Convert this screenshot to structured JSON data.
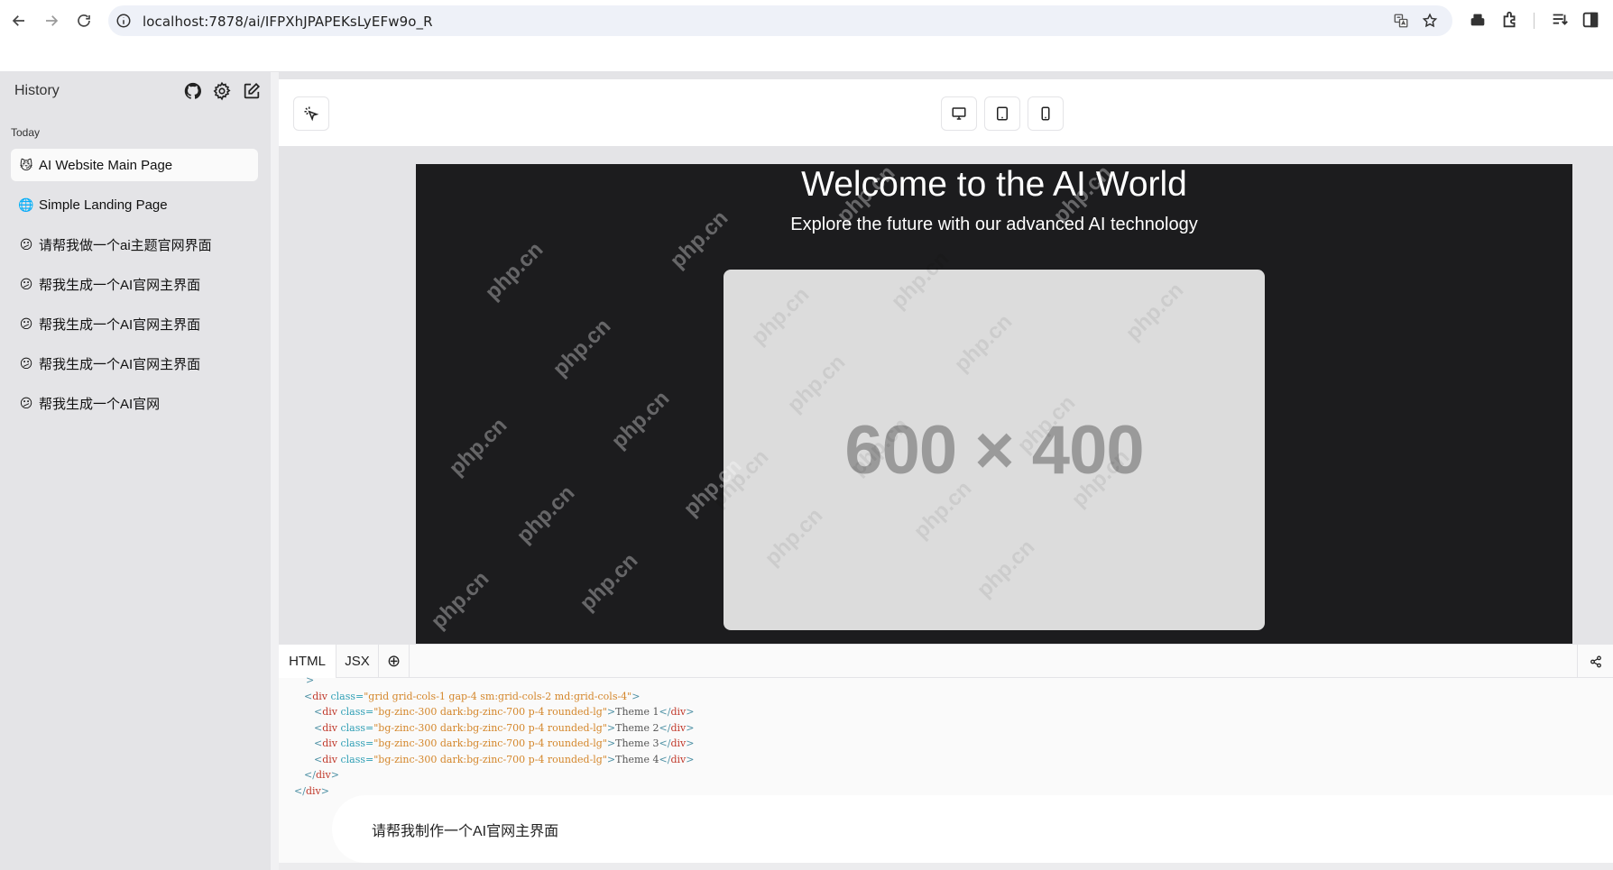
{
  "browser": {
    "url": "localhost:7878/ai/IFPXhJPAPEKsLyEFw9o_R"
  },
  "sidebar": {
    "title": "History",
    "section_label": "Today",
    "items": [
      {
        "icon": "robot-cat-emoji",
        "emoji": "😼",
        "label": "AI Website Main Page",
        "active": true
      },
      {
        "icon": "globe-emoji",
        "emoji": "🌐",
        "label": "Simple Landing Page",
        "active": false
      },
      {
        "icon": "confused-face-emoji",
        "emoji": "😕",
        "label": "请帮我做一个ai主题官网界面",
        "active": false
      },
      {
        "icon": "confused-face-emoji",
        "emoji": "😕",
        "label": "帮我生成一个AI官网主界面",
        "active": false
      },
      {
        "icon": "confused-face-emoji",
        "emoji": "😕",
        "label": "帮我生成一个AI官网主界面",
        "active": false
      },
      {
        "icon": "confused-face-emoji",
        "emoji": "😕",
        "label": "帮我生成一个AI官网主界面",
        "active": false
      },
      {
        "icon": "confused-face-emoji",
        "emoji": "😕",
        "label": "帮我生成一个AI官网",
        "active": false
      }
    ]
  },
  "preview": {
    "title": "Welcome to the AI World",
    "subtitle": "Explore the future with our advanced AI technology",
    "image_placeholder": "600 × 400",
    "watermark": "php.cn",
    "colors": {
      "background": "#1c1c1e",
      "placeholder": "#dcdcdc"
    }
  },
  "code_panel": {
    "tabs": [
      "HTML",
      "JSX"
    ],
    "add_tab_symbol": "⊕",
    "lines": [
      {
        "parts": [
          {
            "t": "tag",
            "v": ">"
          }
        ]
      },
      {
        "parts": [
          {
            "t": "tag",
            "v": "<"
          },
          {
            "t": "el",
            "v": "div"
          },
          {
            "t": "attr",
            "v": " class="
          },
          {
            "t": "str",
            "v": "\"grid grid-cols-1 gap-4 sm:grid-cols-2 md:grid-cols-4\""
          },
          {
            "t": "tag",
            "v": ">"
          }
        ]
      },
      {
        "parts": [
          {
            "t": "tag",
            "v": "<"
          },
          {
            "t": "el",
            "v": "div"
          },
          {
            "t": "attr",
            "v": " class="
          },
          {
            "t": "str",
            "v": "\"bg-zinc-300 dark:bg-zinc-700 p-4 rounded-lg\""
          },
          {
            "t": "tag",
            "v": ">"
          },
          {
            "t": "txt",
            "v": "Theme 1"
          },
          {
            "t": "tag",
            "v": "</"
          },
          {
            "t": "el",
            "v": "div"
          },
          {
            "t": "tag",
            "v": ">"
          }
        ]
      },
      {
        "parts": [
          {
            "t": "tag",
            "v": "<"
          },
          {
            "t": "el",
            "v": "div"
          },
          {
            "t": "attr",
            "v": " class="
          },
          {
            "t": "str",
            "v": "\"bg-zinc-300 dark:bg-zinc-700 p-4 rounded-lg\""
          },
          {
            "t": "tag",
            "v": ">"
          },
          {
            "t": "txt",
            "v": "Theme 2"
          },
          {
            "t": "tag",
            "v": "</"
          },
          {
            "t": "el",
            "v": "div"
          },
          {
            "t": "tag",
            "v": ">"
          }
        ]
      },
      {
        "parts": [
          {
            "t": "tag",
            "v": "<"
          },
          {
            "t": "el",
            "v": "div"
          },
          {
            "t": "attr",
            "v": " class="
          },
          {
            "t": "str",
            "v": "\"bg-zinc-300 dark:bg-zinc-700 p-4 rounded-lg\""
          },
          {
            "t": "tag",
            "v": ">"
          },
          {
            "t": "txt",
            "v": "Theme 3"
          },
          {
            "t": "tag",
            "v": "</"
          },
          {
            "t": "el",
            "v": "div"
          },
          {
            "t": "tag",
            "v": ">"
          }
        ]
      },
      {
        "parts": [
          {
            "t": "tag",
            "v": "<"
          },
          {
            "t": "el",
            "v": "div"
          },
          {
            "t": "attr",
            "v": " class="
          },
          {
            "t": "str",
            "v": "\"bg-zinc-300 dark:bg-zinc-700 p-4 rounded-lg\""
          },
          {
            "t": "tag",
            "v": ">"
          },
          {
            "t": "txt",
            "v": "Theme 4"
          },
          {
            "t": "tag",
            "v": "</"
          },
          {
            "t": "el",
            "v": "div"
          },
          {
            "t": "tag",
            "v": ">"
          }
        ]
      },
      {
        "parts": [
          {
            "t": "tag",
            "v": "</"
          },
          {
            "t": "el",
            "v": "div"
          },
          {
            "t": "tag",
            "v": ">"
          }
        ]
      },
      {
        "parts": [
          {
            "t": "tag",
            "v": "</"
          },
          {
            "t": "el",
            "v": "div"
          },
          {
            "t": "tag",
            "v": ">"
          }
        ]
      }
    ]
  },
  "chat": {
    "message": "请帮我制作一个AI官网主界面"
  }
}
